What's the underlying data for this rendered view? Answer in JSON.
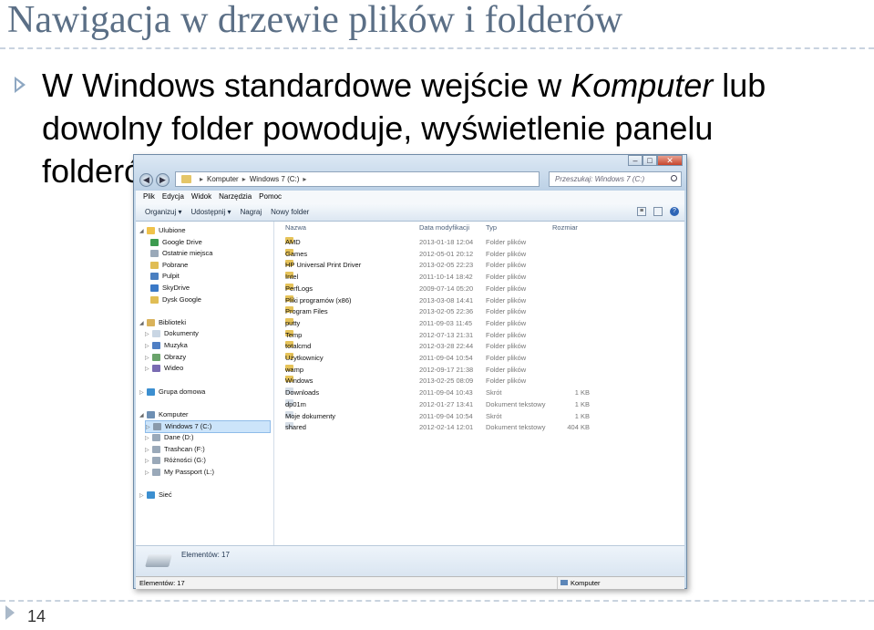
{
  "slide": {
    "title": "Nawigacja w drzewie plików i folderów",
    "bullet_part1": "W Windows standardowe wejście w ",
    "bullet_italic": "Komputer",
    "bullet_part2": " lub dowolny folder powoduje, wyświetlenie panelu folderów",
    "page_number": "14"
  },
  "window": {
    "address": [
      "Komputer",
      "Windows 7 (C:)"
    ],
    "search_placeholder": "Przeszukaj: Windows 7 (C:)",
    "menu": [
      "Plik",
      "Edycja",
      "Widok",
      "Narzędzia",
      "Pomoc"
    ],
    "toolbar": [
      "Organizuj ▾",
      "Udostępnij ▾",
      "Nagraj",
      "Nowy folder"
    ],
    "columns": {
      "name": "Nazwa",
      "date": "Data modyfikacji",
      "type": "Typ",
      "size": "Rozmiar"
    },
    "nav": {
      "favorites": "Ulubione",
      "favorites_items": [
        "Google Drive",
        "Ostatnie miejsca",
        "Pobrane",
        "Pulpit",
        "SkyDrive",
        "Dysk Google"
      ],
      "libraries": "Biblioteki",
      "libraries_items": [
        "Dokumenty",
        "Muzyka",
        "Obrazy",
        "Wideo"
      ],
      "homegroup": "Grupa domowa",
      "computer": "Komputer",
      "computer_items": [
        "Windows 7 (C:)",
        "Dane (D:)",
        "Trashcan (F:)",
        "Różności (G:)",
        "My Passport (L:)"
      ],
      "network": "Sieć"
    },
    "files": [
      {
        "name": "AMD",
        "date": "2013-01-18 12:04",
        "type": "Folder plików",
        "size": ""
      },
      {
        "name": "Games",
        "date": "2012-05-01 20:12",
        "type": "Folder plików",
        "size": ""
      },
      {
        "name": "HP Universal Print Driver",
        "date": "2013-02-05 22:23",
        "type": "Folder plików",
        "size": ""
      },
      {
        "name": "Intel",
        "date": "2011-10-14 18:42",
        "type": "Folder plików",
        "size": ""
      },
      {
        "name": "PerfLogs",
        "date": "2009-07-14 05:20",
        "type": "Folder plików",
        "size": ""
      },
      {
        "name": "Pliki programów (x86)",
        "date": "2013-03-08 14:41",
        "type": "Folder plików",
        "size": ""
      },
      {
        "name": "Program Files",
        "date": "2013-02-05 22:36",
        "type": "Folder plików",
        "size": ""
      },
      {
        "name": "putty",
        "date": "2011-09-03 11:45",
        "type": "Folder plików",
        "size": ""
      },
      {
        "name": "Temp",
        "date": "2012-07-13 21:31",
        "type": "Folder plików",
        "size": ""
      },
      {
        "name": "totalcmd",
        "date": "2012-03-28 22:44",
        "type": "Folder plików",
        "size": ""
      },
      {
        "name": "Użytkownicy",
        "date": "2011-09-04 10:54",
        "type": "Folder plików",
        "size": ""
      },
      {
        "name": "wamp",
        "date": "2012-09-17 21:38",
        "type": "Folder plików",
        "size": ""
      },
      {
        "name": "Windows",
        "date": "2013-02-25 08:09",
        "type": "Folder plików",
        "size": ""
      },
      {
        "name": "Downloads",
        "date": "2011-09-04 10:43",
        "type": "Skrót",
        "size": "1 KB"
      },
      {
        "name": "dp01m",
        "date": "2012-01-27 13:41",
        "type": "Dokument tekstowy",
        "size": "1 KB"
      },
      {
        "name": "Moje dokumenty",
        "date": "2011-09-04 10:54",
        "type": "Skrót",
        "size": "1 KB"
      },
      {
        "name": "shared",
        "date": "2012-02-14 12:01",
        "type": "Dokument tekstowy",
        "size": "404 KB"
      }
    ],
    "details_text": "Elementów: 17",
    "status_left": "Elementów: 17",
    "status_right": "Komputer"
  }
}
